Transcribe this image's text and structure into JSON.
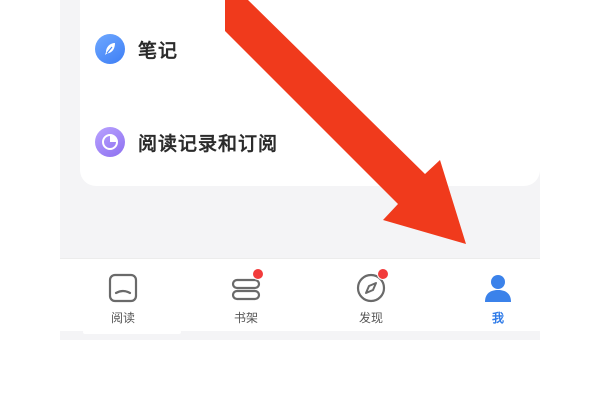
{
  "menu": {
    "items": [
      {
        "label": "笔记",
        "icon": "feather-icon",
        "color": "#4a8cf7"
      },
      {
        "label": "阅读记录和订阅",
        "icon": "pie-clock-icon",
        "color": "#9c82f5"
      }
    ]
  },
  "tabbar": {
    "tabs": [
      {
        "label": "阅读",
        "icon": "reader-icon",
        "badge": false,
        "active": false
      },
      {
        "label": "书架",
        "icon": "books-icon",
        "badge": true,
        "active": false
      },
      {
        "label": "发现",
        "icon": "compass-icon",
        "badge": true,
        "active": false
      },
      {
        "label": "我",
        "icon": "person-icon",
        "badge": false,
        "active": true
      }
    ],
    "active_color": "#2f7be8",
    "badge_color": "#f23b3b"
  },
  "annotation": {
    "arrow_color": "#f03a1c"
  }
}
